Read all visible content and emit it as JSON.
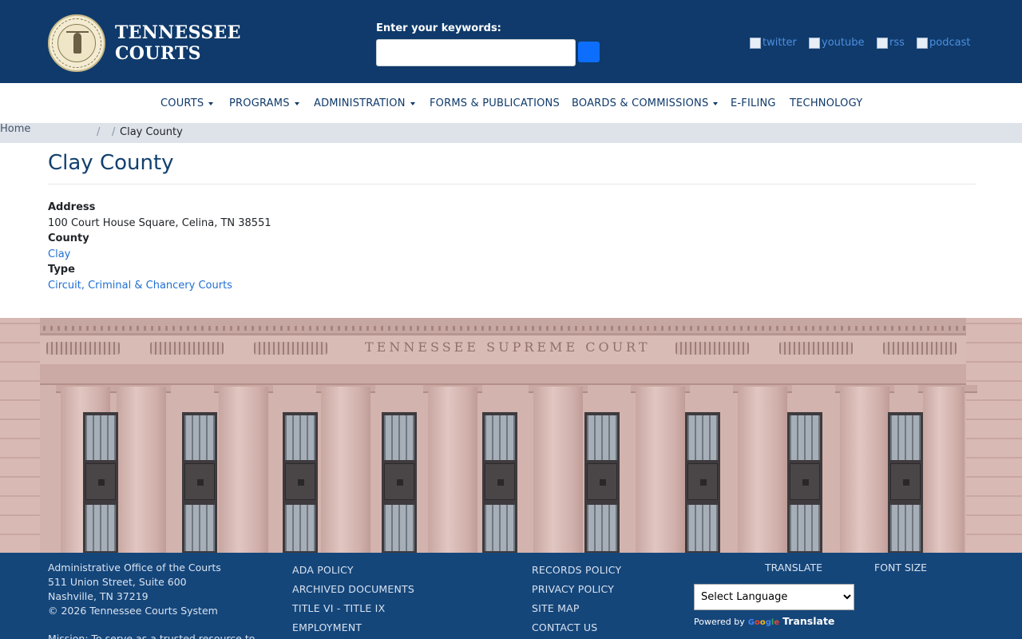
{
  "header": {
    "brand_line1": "TENNESSEE",
    "brand_line2": "COURTS",
    "search_label": "Enter your keywords:",
    "search_value": "",
    "social": [
      {
        "label": "twitter",
        "icon": "twitter-icon"
      },
      {
        "label": "youtube",
        "icon": "youtube-icon"
      },
      {
        "label": "rss",
        "icon": "rss-icon"
      },
      {
        "label": "podcast",
        "icon": "podcast-icon"
      }
    ]
  },
  "nav": {
    "items": [
      {
        "label": "COURTS",
        "dropdown": true
      },
      {
        "label": "PROGRAMS",
        "dropdown": true
      },
      {
        "label": "ADMINISTRATION",
        "dropdown": true
      },
      {
        "label": "FORMS & PUBLICATIONS",
        "dropdown": false
      },
      {
        "label": "BOARDS & COMMISSIONS",
        "dropdown": true
      },
      {
        "label": "E-FILING",
        "dropdown": false
      },
      {
        "label": "TECHNOLOGY",
        "dropdown": false
      }
    ]
  },
  "breadcrumb": {
    "home": "Home",
    "sep1": "/",
    "sep2": "/",
    "current": "Clay County"
  },
  "main": {
    "title": "Clay County",
    "address_label": "Address",
    "address_value": "100 Court House Square, Celina, TN 38551",
    "county_label": "County",
    "county_value": "Clay",
    "type_label": "Type",
    "type_value": "Circuit, Criminal & Chancery Courts"
  },
  "banner": {
    "inscription": "TENNESSEE SUPREME COURT"
  },
  "footer": {
    "org_name": "Administrative Office of the Courts",
    "street": "511 Union Street, Suite 600",
    "city": "Nashville, TN 37219",
    "copyright": "© 2026 Tennessee Courts System",
    "mission": "Mission: To serve as a trusted resource to",
    "links_col1": [
      "ADA POLICY",
      "ARCHIVED DOCUMENTS",
      "TITLE VI - TITLE IX",
      "EMPLOYMENT"
    ],
    "links_col2": [
      "RECORDS POLICY",
      "PRIVACY POLICY",
      "SITE MAP",
      "CONTACT US"
    ],
    "translate_label": "TRANSLATE",
    "font_size_label": "FONT SIZE",
    "language_select": "Select Language",
    "powered_by": "Powered by",
    "google_word": "Google",
    "translate_word": "Translate"
  },
  "colors": {
    "header_bg": "#0f3a6b",
    "footer_bg": "#15467a",
    "link": "#1f6fd1",
    "breadcrumb_bg": "#dee3ea"
  }
}
